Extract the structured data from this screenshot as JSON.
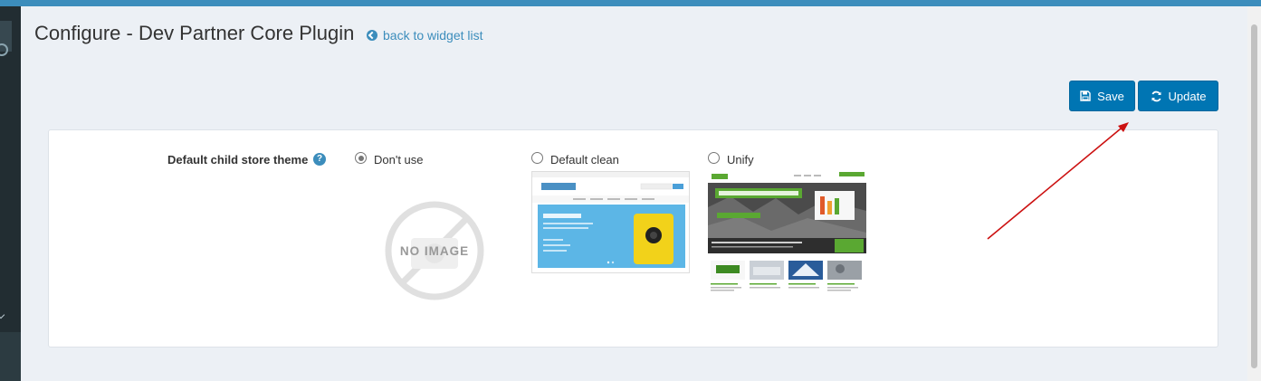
{
  "page": {
    "title": "Configure - Dev Partner Core Plugin",
    "back_link": "back to widget list"
  },
  "toolbar": {
    "save_label": "Save",
    "update_label": "Update"
  },
  "form": {
    "label": "Default child store theme",
    "help": "?",
    "options": [
      {
        "label": "Don't use",
        "checked": true,
        "preview": "NO IMAGE"
      },
      {
        "label": "Default clean",
        "checked": false
      },
      {
        "label": "Unify",
        "checked": false
      }
    ]
  },
  "colors": {
    "topbar": "#3c8dbc",
    "button": "#0075b3",
    "link": "#3c8dbc",
    "annotation_arrow": "#cc1111"
  }
}
